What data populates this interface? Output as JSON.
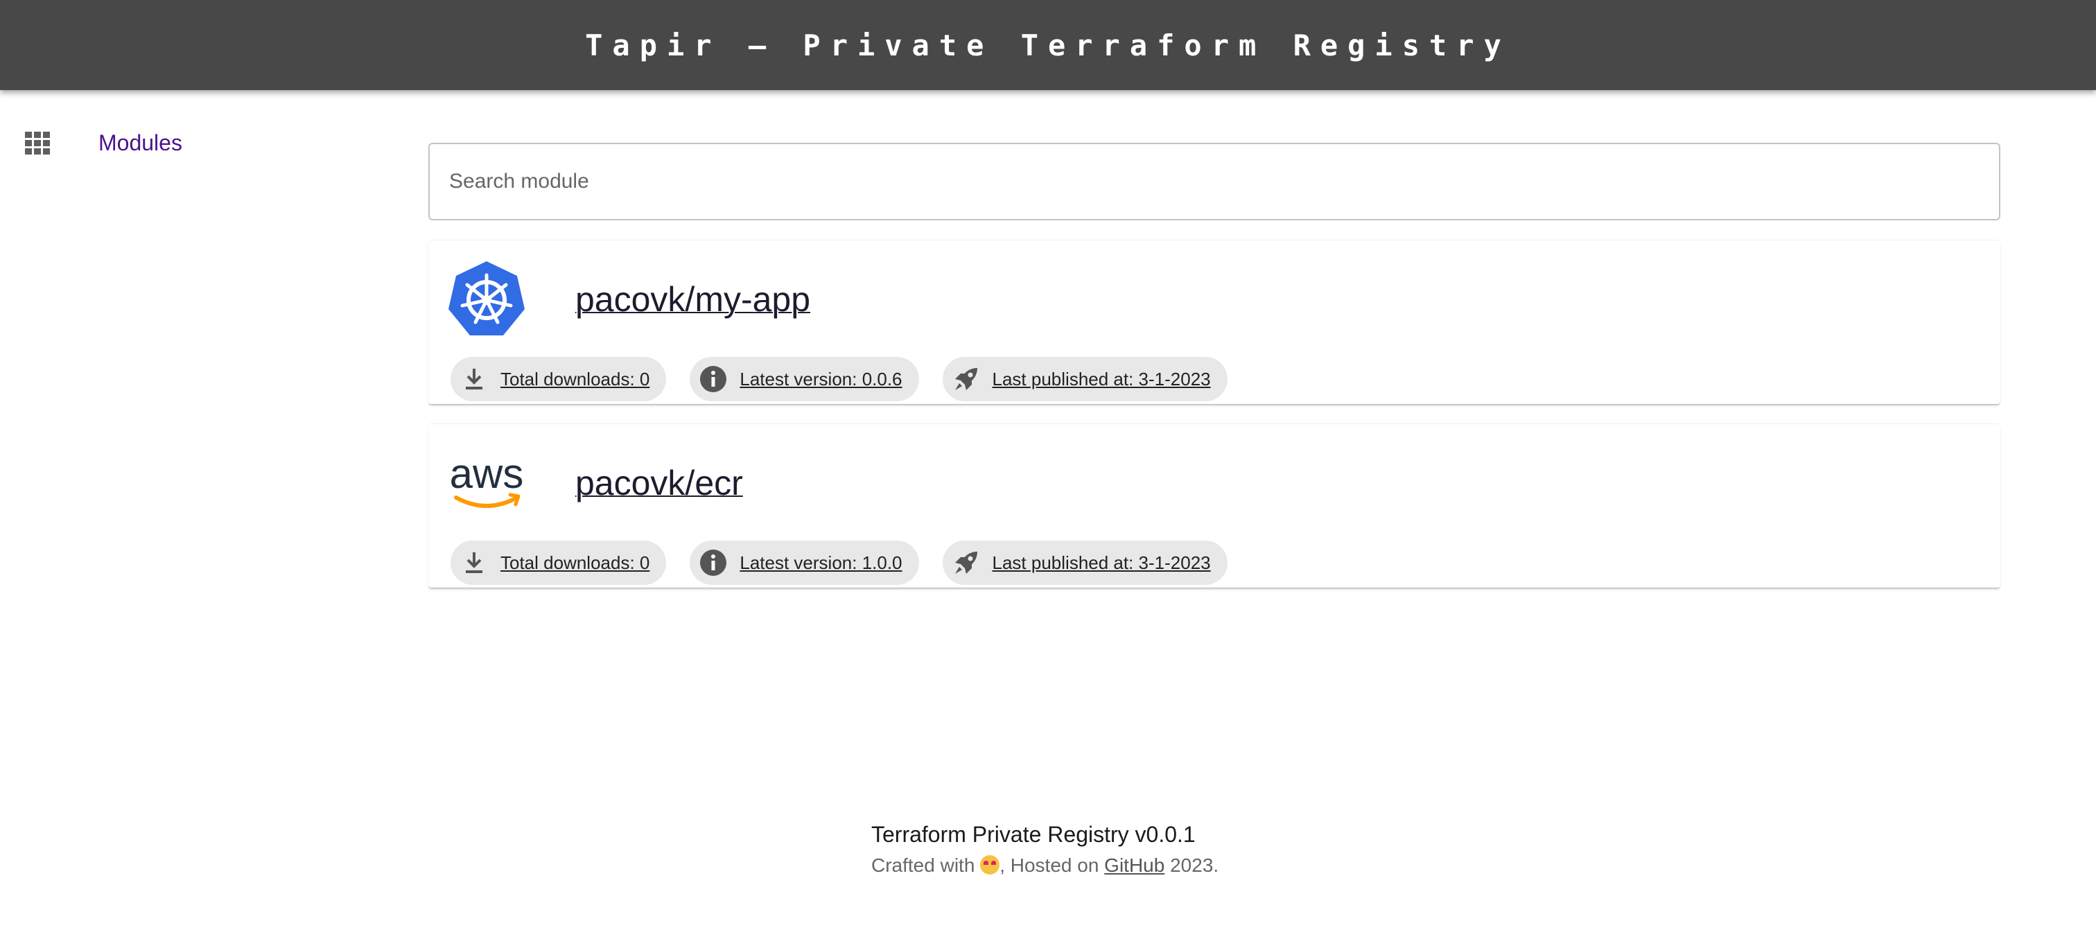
{
  "header": {
    "title": "Tapir – Private Terraform Registry"
  },
  "sidebar": {
    "items": [
      {
        "label": "Modules",
        "icon": "grid-icon"
      }
    ]
  },
  "search": {
    "placeholder": "Search module",
    "value": ""
  },
  "modules": [
    {
      "name": "pacovk/my-app",
      "logo": "kubernetes-logo",
      "downloads": "Total downloads: 0",
      "version": "Latest version: 0.0.6",
      "published": "Last published at: 3-1-2023"
    },
    {
      "name": "pacovk/ecr",
      "logo": "aws-logo",
      "logo_text": "aws",
      "downloads": "Total downloads: 0",
      "version": "Latest version: 1.0.0",
      "published": "Last published at: 3-1-2023"
    }
  ],
  "footer": {
    "line1": "Terraform Private Registry v0.0.1",
    "crafted_prefix": "Crafted with",
    "hosted_on": ", Hosted on",
    "github_link": "GitHub",
    "year": "2023."
  },
  "colors": {
    "topbar": "#484848",
    "accent": "#4a148c",
    "kubernetes_blue": "#326ce5",
    "aws_orange": "#ff9900",
    "chip_bg": "#e8e8e8"
  }
}
